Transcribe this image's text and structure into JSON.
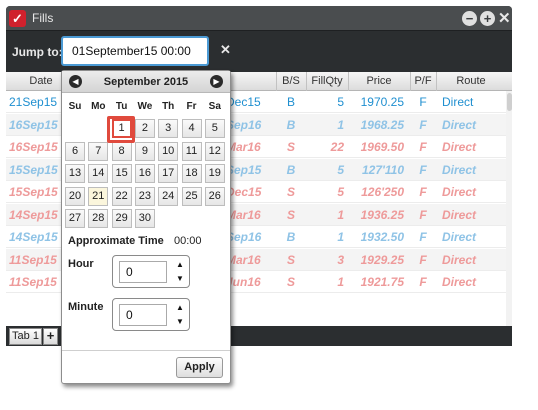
{
  "window": {
    "title": "Fills",
    "logo_icon": "checkmark-icon",
    "minimize_glyph": "−",
    "add_glyph": "+",
    "close_glyph": "✕"
  },
  "jump": {
    "label": "Jump to:",
    "value": "01September15 00:00",
    "clear_glyph": "✕"
  },
  "grid": {
    "columns": [
      "Date",
      "Contract",
      "B/S",
      "FillQty",
      "Price",
      "P/F",
      "Route"
    ],
    "rows": [
      {
        "date": "21Sep15",
        "contract": "Dec15",
        "bs": "B",
        "qty": "5",
        "price": "1970.25",
        "pf": "F",
        "route": "Direct",
        "color": "#1f8fd0",
        "italic": false
      },
      {
        "date": "16Sep15",
        "contract": "Sep16",
        "bs": "B",
        "qty": "1",
        "price": "1968.25",
        "pf": "F",
        "route": "Direct",
        "color": "#8fc3e6",
        "italic": true
      },
      {
        "date": "16Sep15",
        "contract": "Mar16",
        "bs": "S",
        "qty": "22",
        "price": "1969.50",
        "pf": "F",
        "route": "Direct",
        "color": "#ee9a9a",
        "italic": true
      },
      {
        "date": "15Sep15",
        "contract": "Sep15",
        "bs": "B",
        "qty": "5",
        "price": "127'110",
        "pf": "F",
        "route": "Direct",
        "color": "#8fc3e6",
        "italic": true
      },
      {
        "date": "15Sep15",
        "contract": "Dec15",
        "bs": "S",
        "qty": "5",
        "price": "126'250",
        "pf": "F",
        "route": "Direct",
        "color": "#ee9a9a",
        "italic": true
      },
      {
        "date": "14Sep15",
        "contract": "Mar16",
        "bs": "S",
        "qty": "1",
        "price": "1936.25",
        "pf": "F",
        "route": "Direct",
        "color": "#ee9a9a",
        "italic": true
      },
      {
        "date": "14Sep15",
        "contract": "Sep16",
        "bs": "B",
        "qty": "1",
        "price": "1932.50",
        "pf": "F",
        "route": "Direct",
        "color": "#8fc3e6",
        "italic": true
      },
      {
        "date": "11Sep15",
        "contract": "Mar16",
        "bs": "S",
        "qty": "3",
        "price": "1929.25",
        "pf": "F",
        "route": "Direct",
        "color": "#ee9a9a",
        "italic": true
      },
      {
        "date": "11Sep15",
        "contract": "Jun16",
        "bs": "S",
        "qty": "1",
        "price": "1921.75",
        "pf": "F",
        "route": "Direct",
        "color": "#ee9a9a",
        "italic": true
      }
    ]
  },
  "tabs": {
    "items": [
      "Tab 1"
    ],
    "add_glyph": "+"
  },
  "calendar": {
    "month_label": "September 2015",
    "prev_icon": "chevron-left-icon",
    "next_icon": "chevron-right-icon",
    "prev_glyph": "◀",
    "next_glyph": "▶",
    "weekdays": [
      "Su",
      "Mo",
      "Tu",
      "We",
      "Th",
      "Fr",
      "Sa"
    ],
    "weeks": [
      [
        "",
        "",
        "1",
        "2",
        "3",
        "4",
        "5"
      ],
      [
        "6",
        "7",
        "8",
        "9",
        "10",
        "11",
        "12"
      ],
      [
        "13",
        "14",
        "15",
        "16",
        "17",
        "18",
        "19"
      ],
      [
        "20",
        "21",
        "22",
        "23",
        "24",
        "25",
        "26"
      ],
      [
        "27",
        "28",
        "29",
        "30",
        "",
        "",
        ""
      ]
    ],
    "selected_day": "1",
    "today_day": "21",
    "approx_label": "Approximate Time",
    "approx_value": "00:00",
    "hour_label": "Hour",
    "hour_value": "0",
    "minute_label": "Minute",
    "minute_value": "0",
    "spin_up_glyph": "▲",
    "spin_down_glyph": "▼",
    "apply_label": "Apply",
    "highlight_color": "#e04a3d"
  }
}
